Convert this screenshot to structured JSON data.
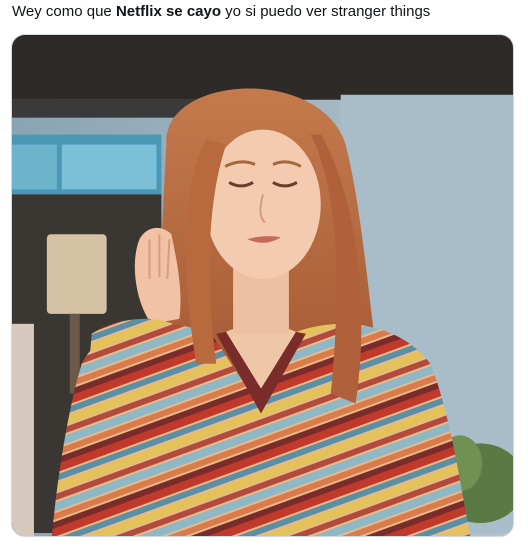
{
  "tweet": {
    "text_prefix": "Wey como que ",
    "text_bold": "Netflix se cayo",
    "text_suffix": " yo si puedo ver stranger things"
  },
  "media": {
    "kind": "photo"
  }
}
